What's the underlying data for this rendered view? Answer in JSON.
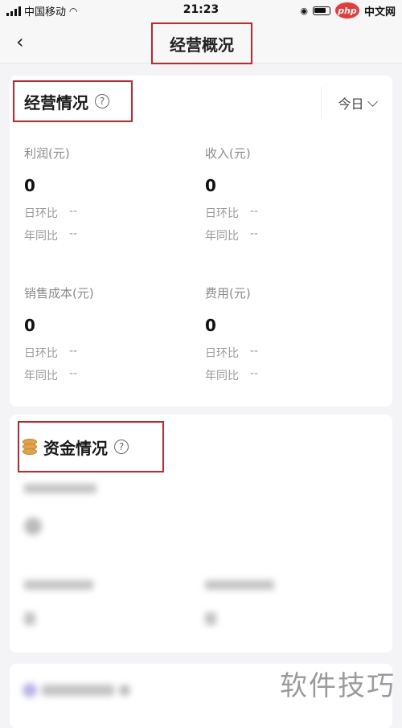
{
  "status_bar": {
    "carrier": "中国移动",
    "time": "21:23",
    "brand_badge": "php",
    "brand_text": "中文网"
  },
  "nav": {
    "back_icon": "chevron-left-icon",
    "title": "经营概况"
  },
  "business": {
    "title": "经营情况",
    "help": "?",
    "period": "今日",
    "metrics": [
      {
        "label": "利润(元)",
        "value": "0",
        "dod_label": "日环比",
        "dod": "--",
        "yoy_label": "年同比",
        "yoy": "--"
      },
      {
        "label": "收入(元)",
        "value": "0",
        "dod_label": "日环比",
        "dod": "--",
        "yoy_label": "年同比",
        "yoy": "--"
      },
      {
        "label": "销售成本(元)",
        "value": "0",
        "dod_label": "日环比",
        "dod": "--",
        "yoy_label": "年同比",
        "yoy": "--"
      },
      {
        "label": "费用(元)",
        "value": "0",
        "dod_label": "日环比",
        "dod": "--",
        "yoy_label": "年同比",
        "yoy": "--"
      }
    ]
  },
  "funds": {
    "title": "资金情况",
    "help": "?"
  },
  "watermark": "软件技巧"
}
